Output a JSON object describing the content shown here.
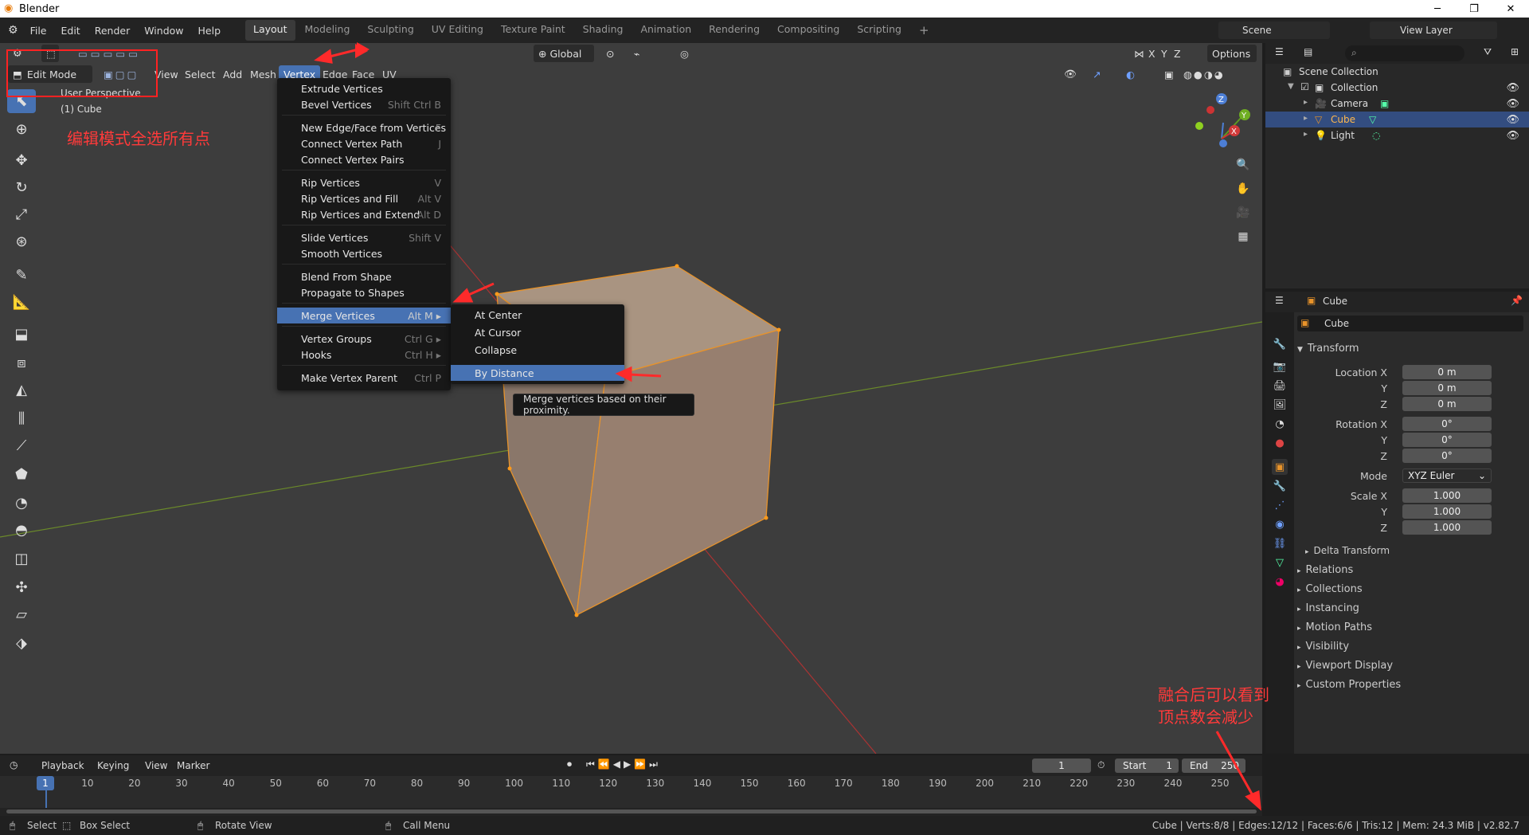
{
  "window": {
    "title": "Blender",
    "min": "─",
    "max": "❐",
    "close": "✕"
  },
  "topmenu": [
    "File",
    "Edit",
    "Render",
    "Window",
    "Help"
  ],
  "workspaces": [
    "Layout",
    "Modeling",
    "Sculpting",
    "UV Editing",
    "Texture Paint",
    "Shading",
    "Animation",
    "Rendering",
    "Compositing",
    "Scripting"
  ],
  "workspace_add": "+",
  "scene": {
    "label": "Scene",
    "view_layer": "View Layer"
  },
  "viewport": {
    "mode": "Edit Mode",
    "menus": [
      "View",
      "Select",
      "Add",
      "Mesh",
      "Vertex",
      "Edge",
      "Face",
      "UV"
    ],
    "transform_orientation": "Global",
    "options": "Options",
    "axes": [
      "X",
      "Y",
      "Z"
    ],
    "overlay_text": [
      "User Perspective",
      "(1) Cube"
    ]
  },
  "vertex_menu": {
    "items": [
      {
        "label": "Extrude Vertices",
        "shortcut": ""
      },
      {
        "label": "Bevel Vertices",
        "shortcut": "Shift Ctrl B"
      },
      {
        "label": "New Edge/Face from Vertices",
        "shortcut": "F"
      },
      {
        "label": "Connect Vertex Path",
        "shortcut": "J"
      },
      {
        "label": "Connect Vertex Pairs",
        "shortcut": ""
      },
      {
        "label": "Rip Vertices",
        "shortcut": "V"
      },
      {
        "label": "Rip Vertices and Fill",
        "shortcut": "Alt V"
      },
      {
        "label": "Rip Vertices and Extend",
        "shortcut": "Alt D"
      },
      {
        "label": "Slide Vertices",
        "shortcut": "Shift V"
      },
      {
        "label": "Smooth Vertices",
        "shortcut": ""
      },
      {
        "label": "Blend From Shape",
        "shortcut": ""
      },
      {
        "label": "Propagate to Shapes",
        "shortcut": ""
      },
      {
        "label": "Merge Vertices",
        "shortcut": "Alt M ▸"
      },
      {
        "label": "Vertex Groups",
        "shortcut": "Ctrl G ▸"
      },
      {
        "label": "Hooks",
        "shortcut": "Ctrl H ▸"
      },
      {
        "label": "Make Vertex Parent",
        "shortcut": "Ctrl P"
      }
    ]
  },
  "merge_submenu": [
    "At Center",
    "At Cursor",
    "Collapse",
    "By Distance"
  ],
  "tooltip": "Merge vertices based on their proximity.",
  "annotations": {
    "select_all_note": "编辑模式全选所有点",
    "after_merge_line1": "融合后可以看到",
    "after_merge_line2": "顶点数会减少"
  },
  "outliner": {
    "root": "Scene Collection",
    "collection": "Collection",
    "items": [
      "Camera",
      "Cube",
      "Light"
    ]
  },
  "properties": {
    "object_name": "Cube",
    "data_name": "Cube",
    "transform_title": "Transform",
    "location_label": "Location X",
    "rotation_label": "Rotation X",
    "scale_label": "Scale X",
    "y_label": "Y",
    "z_label": "Z",
    "location": [
      "0 m",
      "0 m",
      "0 m"
    ],
    "rotation": [
      "0°",
      "0°",
      "0°"
    ],
    "mode_label": "Mode",
    "mode_value": "XYZ Euler",
    "scale": [
      "1.000",
      "1.000",
      "1.000"
    ],
    "delta": "Delta Transform",
    "sections": [
      "Relations",
      "Collections",
      "Instancing",
      "Motion Paths",
      "Visibility",
      "Viewport Display",
      "Custom Properties"
    ]
  },
  "timeline": {
    "menus": [
      "Playback",
      "Keying",
      "View",
      "Marker"
    ],
    "current_frame": "1",
    "start_label": "Start",
    "start": "1",
    "end_label": "End",
    "end": "250",
    "ticks": [
      "1",
      "10",
      "20",
      "30",
      "40",
      "50",
      "60",
      "70",
      "80",
      "90",
      "100",
      "110",
      "120",
      "130",
      "140",
      "150",
      "160",
      "170",
      "180",
      "190",
      "200",
      "210",
      "220",
      "230",
      "240",
      "250"
    ]
  },
  "statusbar": {
    "select": "Select",
    "box_select": "Box Select",
    "rotate": "Rotate View",
    "call_menu": "Call Menu",
    "stats": "Cube | Verts:8/8 | Edges:12/12 | Faces:6/6 | Tris:12 | Mem: 24.3 MiB | v2.82.7"
  },
  "colors": {
    "accent": "#4772b3",
    "annotation": "#ff2a2a",
    "cube": "#a08a78"
  }
}
